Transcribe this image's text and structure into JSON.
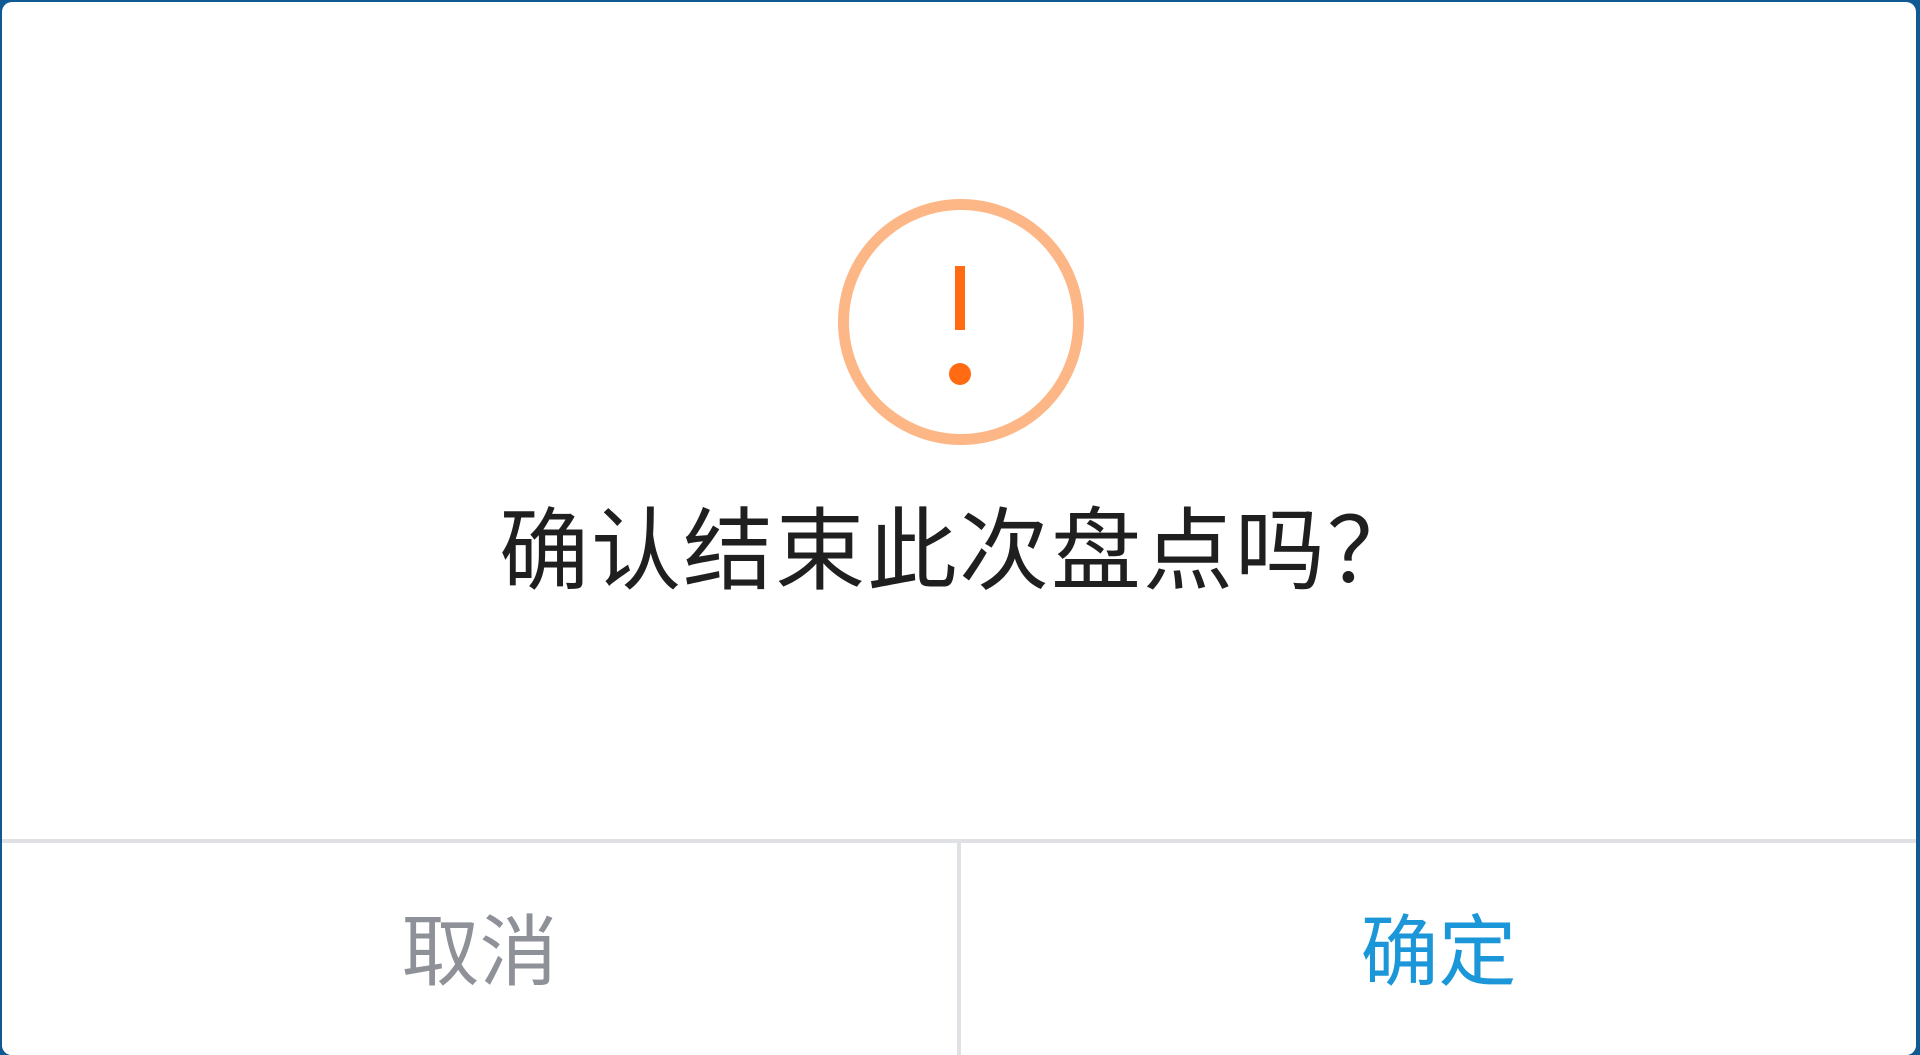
{
  "dialog": {
    "icon": "warning-exclamation-icon",
    "message": "确认结束此次盘点吗？",
    "cancel_label": "取消",
    "confirm_label": "确定"
  },
  "colors": {
    "backdrop": "#0f5a93",
    "icon_ring": "#fdb787",
    "icon_mark": "#ff6a13",
    "message_text": "#1f1f1f",
    "cancel_text": "#8e9197",
    "confirm_text": "#1a96d9",
    "divider": "#e0e1e4"
  }
}
